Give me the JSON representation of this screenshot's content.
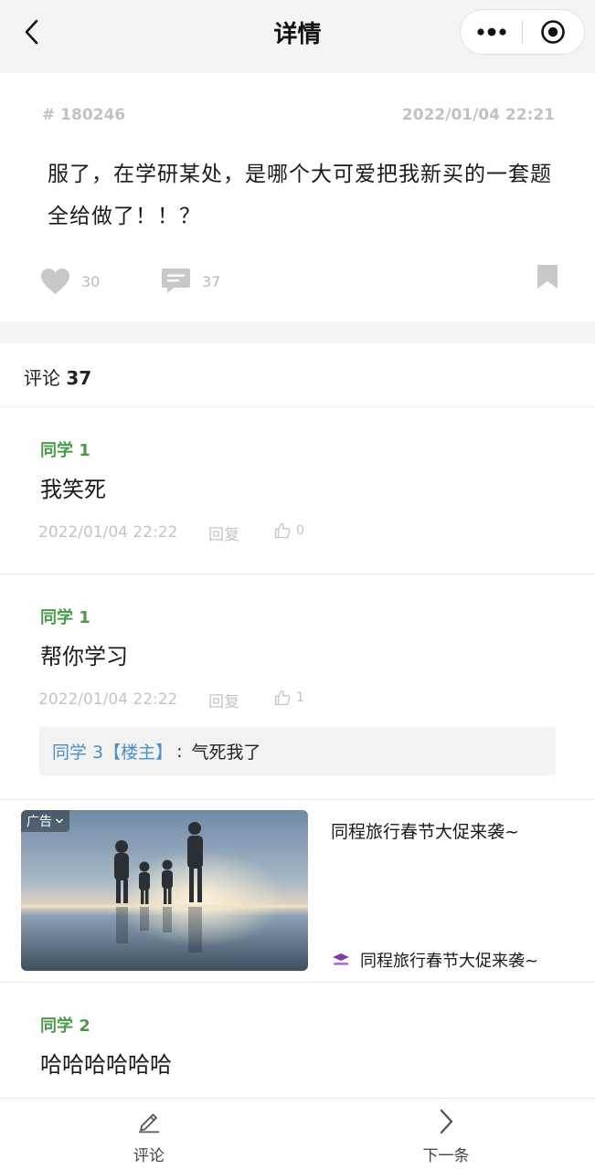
{
  "nav": {
    "title": "详情",
    "back_icon": "chevron-left-icon",
    "capsule": {
      "more_icon": "more-dots-icon",
      "close_icon": "target-circle-icon"
    }
  },
  "post": {
    "id": "# 180246",
    "time": "2022/01/04 22:21",
    "content": "服了，在学研某处，是哪个大可爱把我新买的一套题全给做了！！？",
    "likes": "30",
    "comments": "37"
  },
  "comments_header": {
    "label": "评论",
    "count": "37"
  },
  "comments": [
    {
      "author": "同学 1",
      "text": "我笑死",
      "time": "2022/01/04 22:22",
      "reply_label": "回复",
      "likes": "0"
    },
    {
      "author": "同学 1",
      "text": "帮你学习",
      "time": "2022/01/04 22:22",
      "reply_label": "回复",
      "likes": "1",
      "sub_reply": {
        "author": "同学 3【楼主】",
        "colon": ":",
        "text": "气死我了"
      }
    },
    {
      "author": "同学 2",
      "text": "哈哈哈哈哈哈"
    }
  ],
  "ad": {
    "tag": "广告",
    "title": "同程旅行春节大促来袭~",
    "brand_name": "同程旅行春节大促来袭~"
  },
  "bottom_bar": {
    "comment_label": "评论",
    "next_label": "下一条"
  },
  "colors": {
    "author_green": "#4a9a4a",
    "reply_blue": "#4d8fc4",
    "muted_gray": "#c4c4c4"
  }
}
